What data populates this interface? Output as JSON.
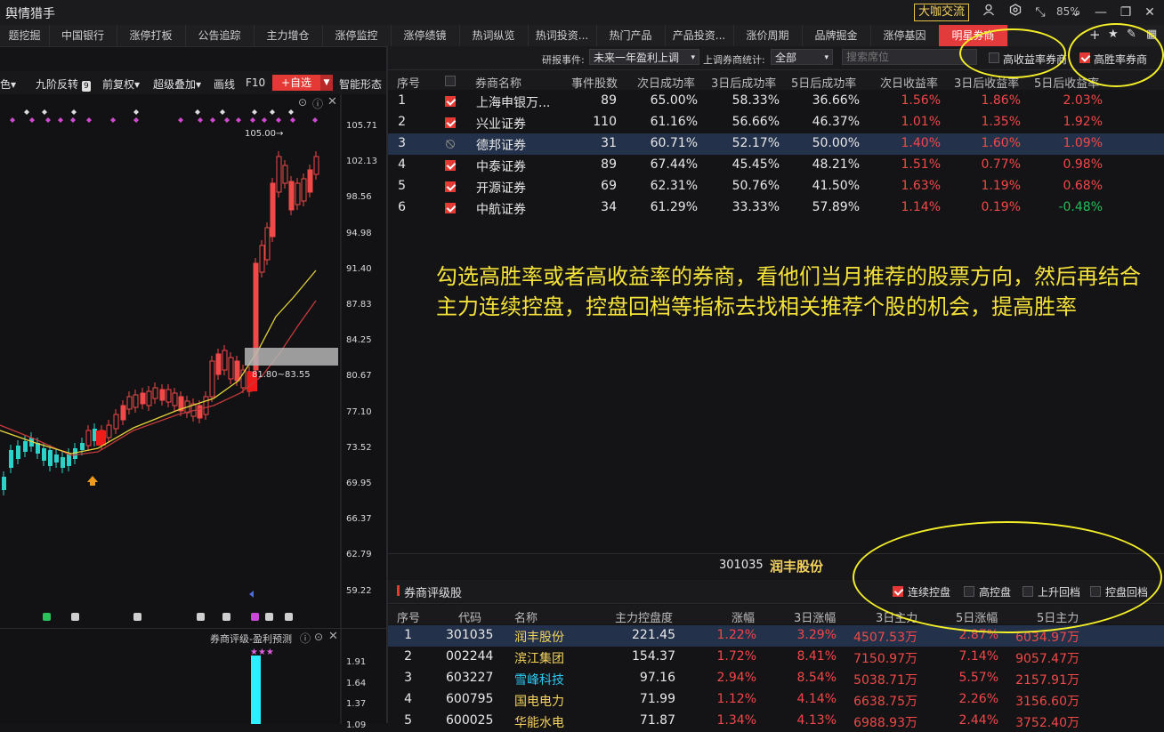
{
  "app": {
    "title": "舆情猎手",
    "vip_button": "大咖交流",
    "zoom": "85%"
  },
  "tabs": [
    "题挖掘",
    "中国银行",
    "涨停打板",
    "公告追踪",
    "主力增仓",
    "涨停监控",
    "涨停绩镜",
    "热词纵览",
    "热词投资...",
    "热门产品",
    "产品投资...",
    "涨价周期",
    "品牌掘金",
    "涨停基因",
    "明星券商"
  ],
  "active_tab": "明星券商",
  "left_toolbar": {
    "items": [
      "色",
      "九阶反转",
      "前复权",
      "超级叠加",
      "画线",
      "F10"
    ],
    "add_favorite": "+自选",
    "pattern": "智能形态"
  },
  "filters": {
    "event_label": "研报事件:",
    "event_value": "未来一年盈利上调",
    "broker_label": "上调券商统计:",
    "broker_value": "全部",
    "search_placeholder": "搜索席位",
    "high_return_label": "高收益率券商",
    "high_winrate_label": "高胜率券商"
  },
  "broker_table": {
    "headers": [
      "序号",
      "",
      "券商名称",
      "事件股数",
      "次日成功率",
      "3日后成功率",
      "5日后成功率",
      "次日收益率",
      "3日后收益率",
      "5日后收益率"
    ],
    "rows": [
      {
        "no": "1",
        "checked": "on",
        "name": "上海申银万...",
        "count": "89",
        "d1": "65.00%",
        "d3": "58.33%",
        "d5": "36.66%",
        "r1": "1.56%",
        "r3": "1.86%",
        "r5": "2.03%",
        "r5c": "red"
      },
      {
        "no": "2",
        "checked": "on",
        "name": "兴业证券",
        "count": "110",
        "d1": "61.16%",
        "d3": "56.66%",
        "d5": "46.37%",
        "r1": "1.01%",
        "r3": "1.35%",
        "r5": "1.92%",
        "r5c": "red"
      },
      {
        "no": "3",
        "checked": "dis",
        "name": "德邦证券",
        "count": "31",
        "d1": "60.71%",
        "d3": "52.17%",
        "d5": "50.00%",
        "r1": "1.40%",
        "r3": "1.60%",
        "r5": "1.09%",
        "r5c": "red"
      },
      {
        "no": "4",
        "checked": "on",
        "name": "中泰证券",
        "count": "89",
        "d1": "67.44%",
        "d3": "45.45%",
        "d5": "48.21%",
        "r1": "1.51%",
        "r3": "0.77%",
        "r5": "0.98%",
        "r5c": "red"
      },
      {
        "no": "5",
        "checked": "on",
        "name": "开源证券",
        "count": "69",
        "d1": "62.31%",
        "d3": "50.76%",
        "d5": "41.50%",
        "r1": "1.63%",
        "r3": "1.19%",
        "r5": "0.68%",
        "r5c": "red"
      },
      {
        "no": "6",
        "checked": "on",
        "name": "中航证券",
        "count": "34",
        "d1": "61.29%",
        "d3": "33.33%",
        "d5": "57.89%",
        "r1": "1.14%",
        "r3": "0.19%",
        "r5": "-0.48%",
        "r5c": "green"
      }
    ]
  },
  "annotation": "勾选高胜率或者高收益率的券商，看他们当月推荐的股票方向，然后再结合主力连续控盘，控盘回档等指标去找相关推荐个股的机会，提高胜率",
  "selected_stock": {
    "code": "301035",
    "name": "润丰股份"
  },
  "rated_panel": {
    "title": "券商评级股",
    "options": [
      {
        "label": "连续控盘",
        "checked": true
      },
      {
        "label": "高控盘",
        "checked": false
      },
      {
        "label": "上升回档",
        "checked": false
      },
      {
        "label": "控盘回档",
        "checked": false
      }
    ]
  },
  "stock_table": {
    "headers": [
      "序号",
      "代码",
      "名称",
      "主力控盘度",
      "涨幅",
      "3日涨幅",
      "3日主力",
      "5日涨幅",
      "5日主力"
    ],
    "rows": [
      {
        "no": "1",
        "code": "301035",
        "name": "润丰股份",
        "ctrl": "221.45",
        "chg": "1.22%",
        "chg3": "3.29%",
        "main3": "4507.53万",
        "chg5": "2.87%",
        "main5": "6034.97万"
      },
      {
        "no": "2",
        "code": "002244",
        "name": "滨江集团",
        "ctrl": "154.37",
        "chg": "1.72%",
        "chg3": "8.41%",
        "main3": "7150.97万",
        "chg5": "7.14%",
        "main5": "9057.47万"
      },
      {
        "no": "3",
        "code": "603227",
        "name": "雪峰科技",
        "ctrl": "97.16",
        "chg": "2.94%",
        "chg3": "8.54%",
        "main3": "5038.71万",
        "chg5": "5.57%",
        "main5": "2157.91万"
      },
      {
        "no": "4",
        "code": "600795",
        "name": "国电电力",
        "ctrl": "71.99",
        "chg": "1.12%",
        "chg3": "4.14%",
        "main3": "6638.75万",
        "chg5": "2.26%",
        "main5": "3156.60万"
      },
      {
        "no": "5",
        "code": "600025",
        "name": "华能水电",
        "ctrl": "71.87",
        "chg": "1.34%",
        "chg3": "4.13%",
        "main3": "6988.93万",
        "chg5": "2.44%",
        "main5": "3752.40万"
      }
    ]
  },
  "price_chart": {
    "y_ticks": [
      "105.71",
      "102.13",
      "98.56",
      "94.98",
      "91.40",
      "87.83",
      "84.25",
      "80.67",
      "77.10",
      "73.52",
      "69.95",
      "66.37",
      "62.79",
      "59.22"
    ],
    "high_label": "105.00→",
    "zone_label": "81.80~83.55"
  },
  "sub_chart": {
    "title": "券商评级-盈利预测",
    "y_ticks": [
      "1.91",
      "1.64",
      "1.37",
      "1.09"
    ]
  },
  "colors": {
    "up": "#f14848",
    "down": "#22c05a",
    "accent": "#e53935",
    "highlight": "#f4ee29"
  }
}
